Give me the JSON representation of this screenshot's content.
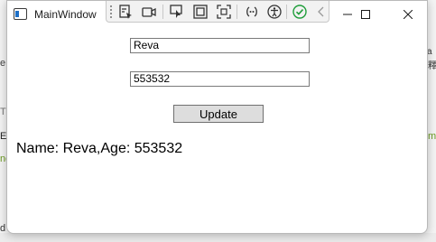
{
  "window": {
    "title": "MainWindow"
  },
  "form": {
    "name_value": "Reva",
    "age_value": "553532",
    "update_label": "Update",
    "result_text": "Name: Reva,Age: 553532"
  },
  "debug_toolbar": {
    "icons": [
      "select-element-icon",
      "video-record-icon",
      "cursor-select-icon",
      "display-layout-adorners-icon",
      "track-focus-icon",
      "binding-failures-icon",
      "accessibility-icon",
      "hot-reload-check-icon",
      "collapse-chevron-icon"
    ],
    "hot_reload_color": "#1f9d3a"
  },
  "backdrop": {
    "left_fragments": [
      "e",
      "T",
      "Er",
      "ne",
      "d"
    ],
    "right_fragments": [
      "a",
      "釋",
      "me"
    ]
  }
}
